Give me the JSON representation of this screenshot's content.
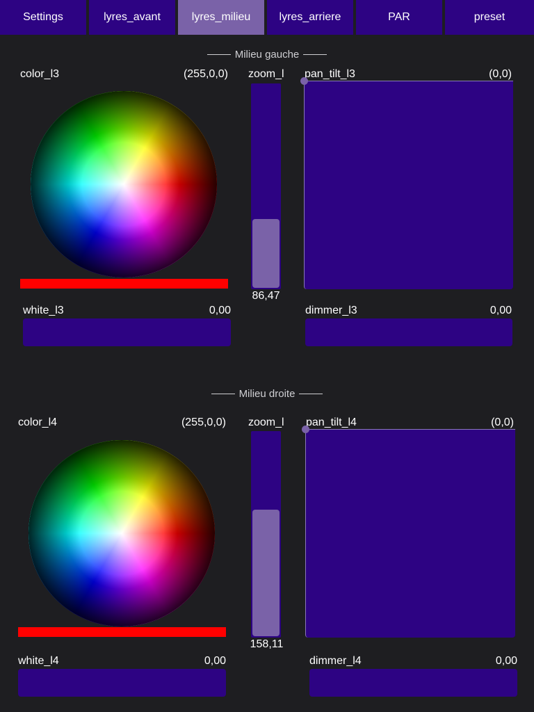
{
  "tabs": [
    {
      "label": "Settings"
    },
    {
      "label": "lyres_avant"
    },
    {
      "label": "lyres_milieu",
      "active": true
    },
    {
      "label": "lyres_arriere"
    },
    {
      "label": "PAR"
    },
    {
      "label": "preset"
    }
  ],
  "sections": [
    {
      "title": "Milieu gauche",
      "color": {
        "label": "color_l3",
        "value": "(255,0,0)",
        "swatch": "#ff0000"
      },
      "zoom": {
        "label": "zoom_l",
        "value": "86,47",
        "level": 0.34
      },
      "pan_tilt": {
        "label": "pan_tilt_l3",
        "value": "(0,0)"
      },
      "white": {
        "label": "white_l3",
        "value": "0,00"
      },
      "dimmer": {
        "label": "dimmer_l3",
        "value": "0,00"
      }
    },
    {
      "title": "Milieu droite",
      "color": {
        "label": "color_l4",
        "value": "(255,0,0)",
        "swatch": "#ff0000"
      },
      "zoom": {
        "label": "zoom_l",
        "value": "158,11",
        "level": 0.62
      },
      "pan_tilt": {
        "label": "pan_tilt_l4",
        "value": "(0,0)"
      },
      "white": {
        "label": "white_l4",
        "value": "0,00"
      },
      "dimmer": {
        "label": "dimmer_l4",
        "value": "0,00"
      }
    }
  ],
  "colors": {
    "background": "#1e1e21",
    "control": "#2d0383",
    "accent": "#7a62a8"
  }
}
